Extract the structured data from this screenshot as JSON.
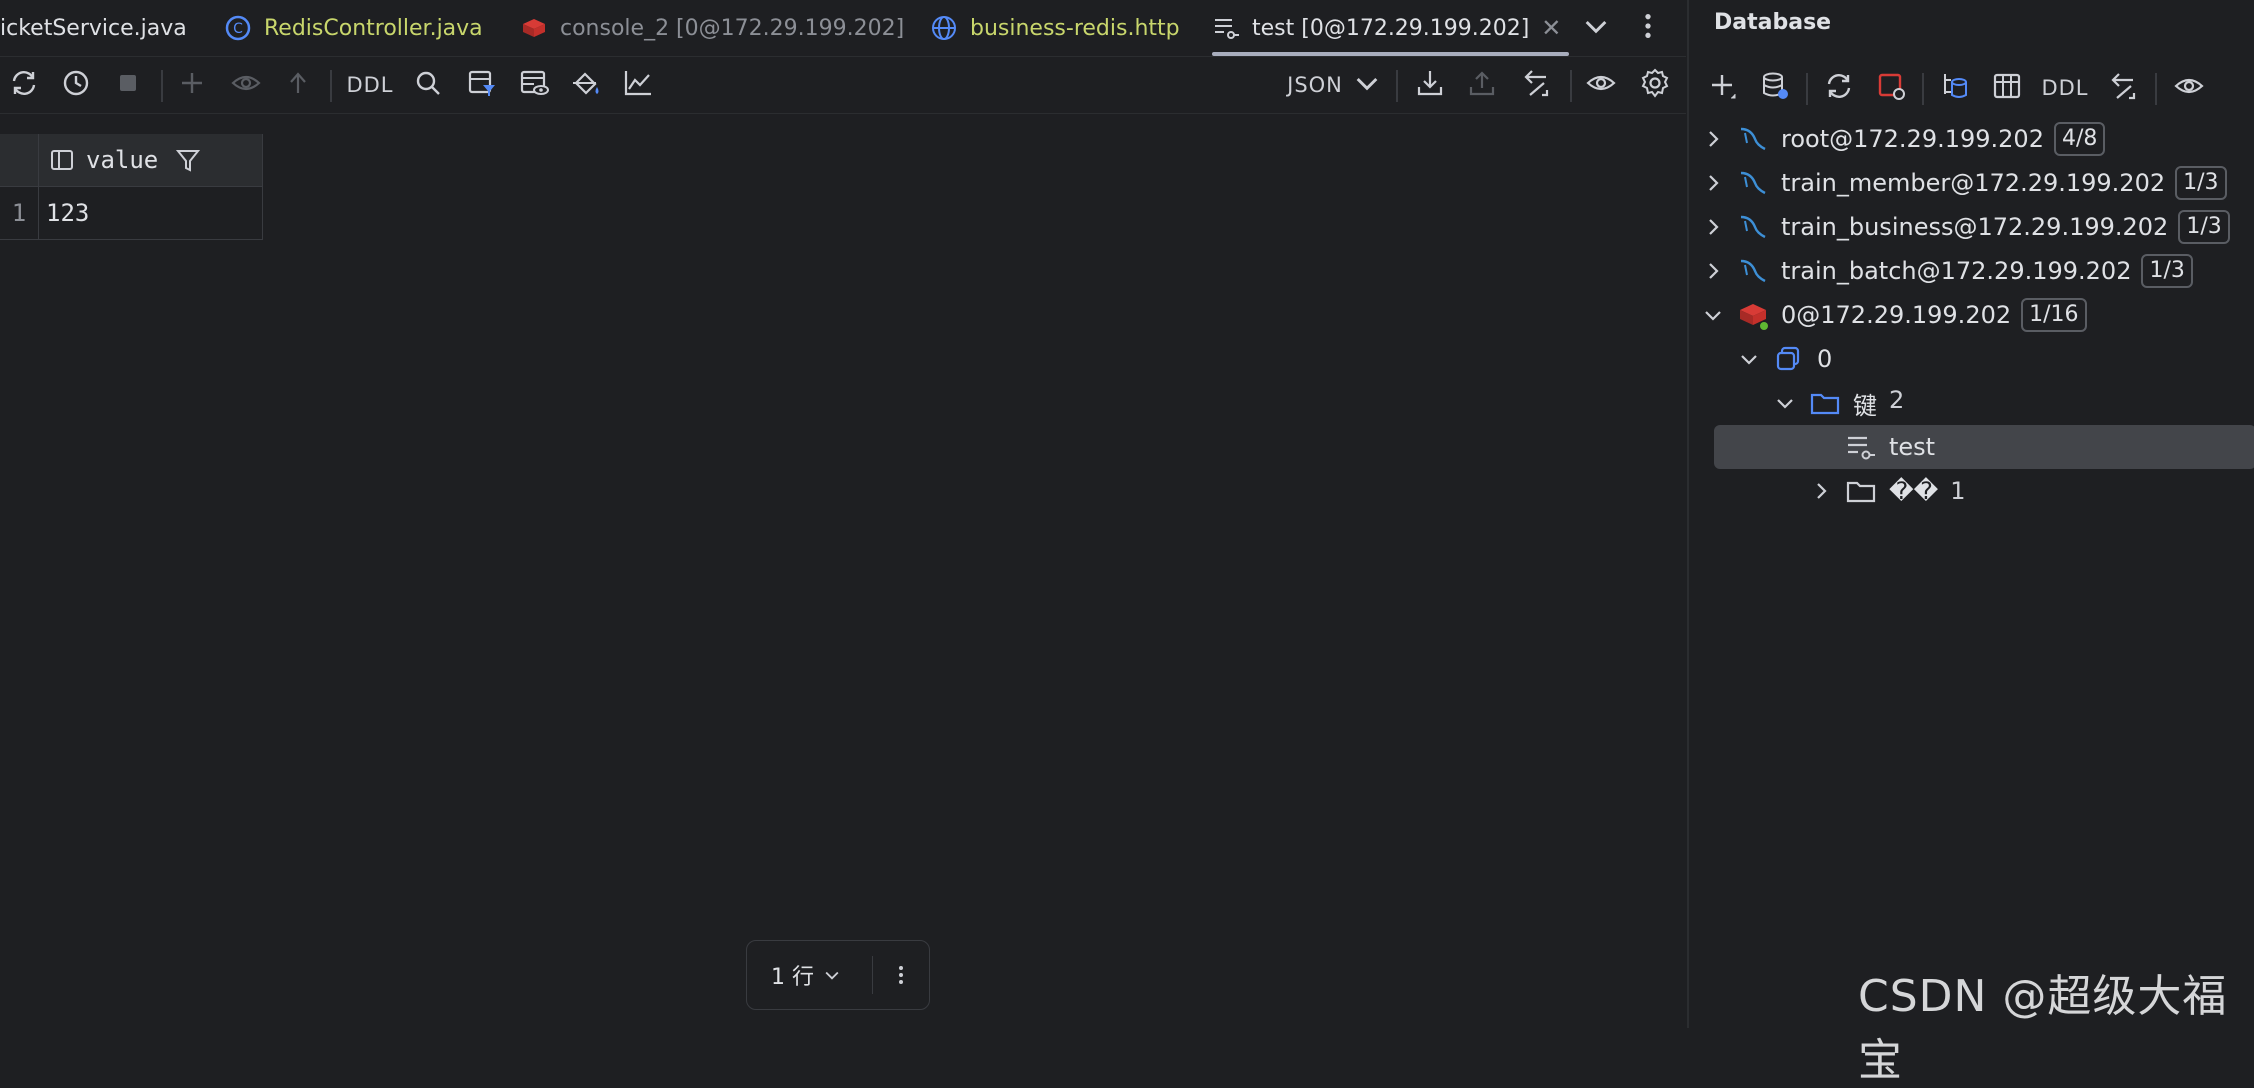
{
  "tabs": [
    {
      "label": "icketService.java",
      "color": "#dfe1e5"
    },
    {
      "label": "RedisController.java",
      "color": "#c8d66c"
    },
    {
      "label": "console_2 [0@172.29.199.202]",
      "color": "#8c8f96"
    },
    {
      "label": "business-redis.http",
      "color": "#c8d66c"
    },
    {
      "label": "test [0@172.29.199.202]",
      "color": "#dfe1e5"
    }
  ],
  "toolbar": {
    "ddl_label": "DDL",
    "format_label": "JSON"
  },
  "grid": {
    "columns": [
      "value"
    ],
    "rows": [
      {
        "num": "1",
        "value": "123"
      }
    ]
  },
  "pager": {
    "rows_label": "1 行"
  },
  "database": {
    "title": "Database",
    "ddl_label": "DDL",
    "tree": [
      {
        "label": "root@172.29.199.202",
        "badge": "4/8"
      },
      {
        "label": "train_member@172.29.199.202",
        "badge": "1/3"
      },
      {
        "label": "train_business@172.29.199.202",
        "badge": "1/3"
      },
      {
        "label": "train_batch@172.29.199.202",
        "badge": "1/3"
      },
      {
        "label": "0@172.29.199.202",
        "badge": "1/16"
      },
      {
        "label": "0"
      },
      {
        "label": "键",
        "count": "2"
      },
      {
        "label": "test"
      },
      {
        "label": "��",
        "count": "1"
      }
    ]
  },
  "watermark": "CSDN @超级大福宝",
  "colors": {
    "background": "#1e1f22",
    "panel": "#2b2d30",
    "selected": "#43454a",
    "mysql_blue": "#3d8fd6",
    "redis_red": "#d83b36",
    "folder_blue": "#548af7"
  }
}
